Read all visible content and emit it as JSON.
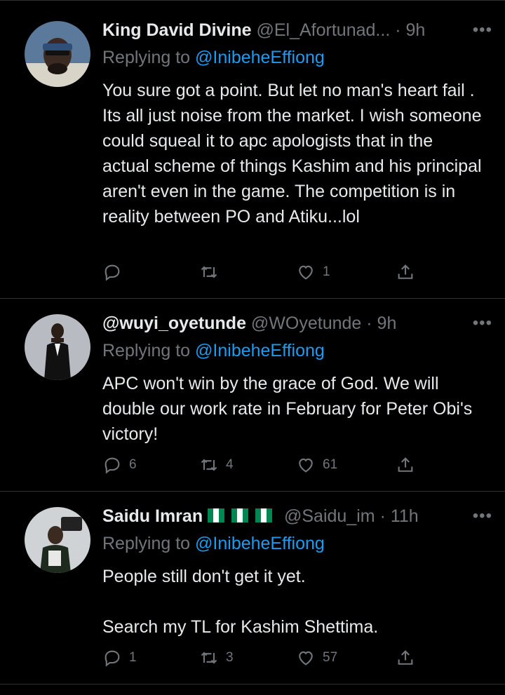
{
  "tweets": [
    {
      "name": "King David Divine",
      "handle": "@El_Afortunad...",
      "dot": "·",
      "time": "9h",
      "replying_prefix": "Replying to ",
      "replying_to": "@InibeheEffiong",
      "text": "You sure got a point. But let no man's heart fail . Its all just noise from the market. I wish someone could squeal it to apc apologists that in the  actual scheme of things Kashim and his principal aren't even in the game. The competition is in reality between PO and Atiku...lol",
      "replies": "",
      "retweets": "",
      "likes": "1"
    },
    {
      "name": "@wuyi_oyetunde",
      "handle": "@WOyetunde",
      "dot": "·",
      "time": "9h",
      "replying_prefix": "Replying to ",
      "replying_to": "@InibeheEffiong",
      "text": "APC won't win by the grace of God. We will double our work rate in February for Peter Obi's victory!",
      "replies": "6",
      "retweets": "4",
      "likes": "61"
    },
    {
      "name": "Saidu Imran",
      "flags": [
        "nigeria-flag",
        "nigeria-flag",
        "nigeria-flag"
      ],
      "handle": "@Saidu_im",
      "dot": "·",
      "time": "11h",
      "replying_prefix": "Replying to ",
      "replying_to": "@InibeheEffiong",
      "text": "People still don't get it yet.\n\nSearch my TL for Kashim Shettima.",
      "replies": "1",
      "retweets": "3",
      "likes": "57"
    }
  ],
  "more_label": "•••",
  "colors": {
    "background": "#000000",
    "text": "#e7e9ea",
    "muted": "#71767b",
    "link": "#1d9bf0",
    "divider": "#2f3336",
    "flag_green": "#008751",
    "flag_white": "#ffffff"
  }
}
